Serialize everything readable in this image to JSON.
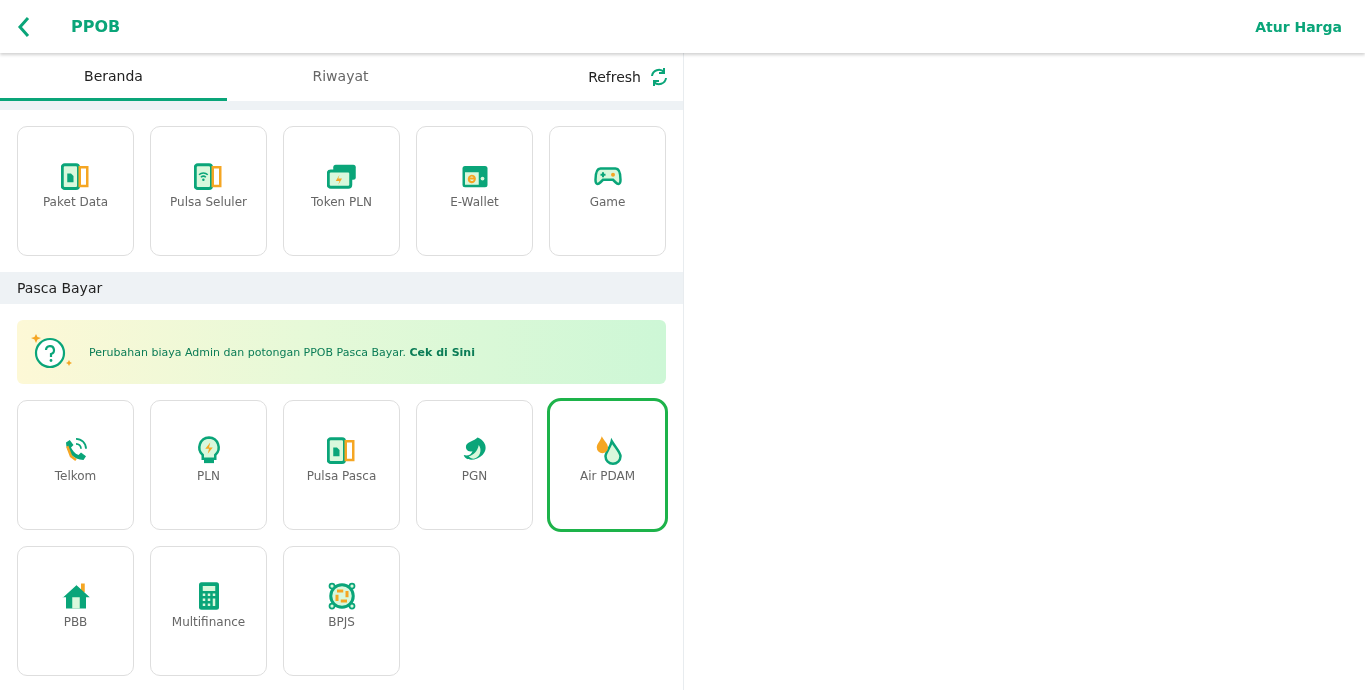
{
  "header": {
    "title": "PPOB",
    "action": "Atur Harga"
  },
  "tabs": [
    {
      "label": "Beranda",
      "selected": true
    },
    {
      "label": "Riwayat",
      "selected": false
    }
  ],
  "refresh": "Refresh",
  "prabayar": {
    "items": [
      {
        "label": "Paket Data",
        "selected": false
      },
      {
        "label": "Pulsa Seluler",
        "selected": false
      },
      {
        "label": "Token PLN",
        "selected": false
      },
      {
        "label": "E-Wallet",
        "selected": false
      },
      {
        "label": "Game",
        "selected": false
      }
    ]
  },
  "pasca_bayar": {
    "title": "Pasca Bayar",
    "banner": {
      "text": "Perubahan biaya Admin dan potongan PPOB Pasca Bayar.",
      "link": "Cek di Sini"
    },
    "items": [
      {
        "label": "Telkom",
        "selected": false
      },
      {
        "label": "PLN",
        "selected": false
      },
      {
        "label": "Pulsa Pasca",
        "selected": false
      },
      {
        "label": "PGN",
        "selected": false
      },
      {
        "label": "Air PDAM",
        "selected": true
      },
      {
        "label": "PBB",
        "selected": false
      },
      {
        "label": "Multifinance",
        "selected": false
      },
      {
        "label": "BPJS",
        "selected": false
      }
    ]
  }
}
